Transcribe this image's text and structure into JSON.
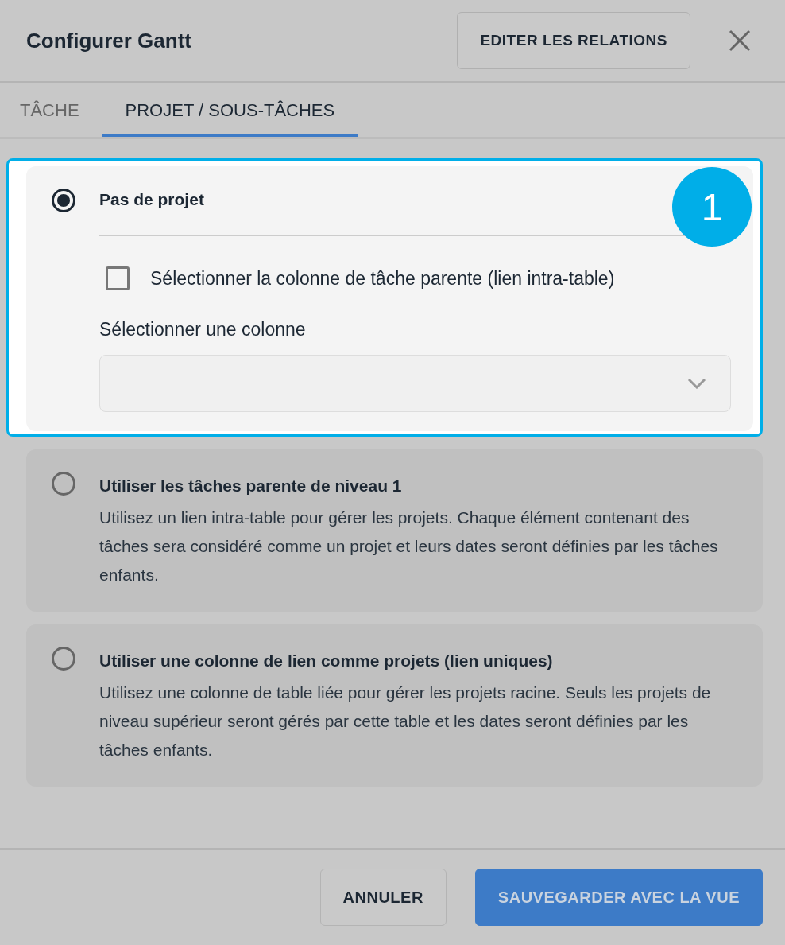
{
  "dialog": {
    "title": "Configurer Gantt",
    "header_button": "EDITER LES RELATIONS"
  },
  "tabs": [
    {
      "label": "TÂCHE",
      "selected": false
    },
    {
      "label": "PROJET / SOUS-TÂCHES",
      "selected": true
    }
  ],
  "options": [
    {
      "title": "Pas de projet",
      "selected": true,
      "highlighted": true,
      "step": "1",
      "checkbox": {
        "label": "Sélectionner la colonne de tâche parente (lien intra-table)",
        "checked": false
      },
      "select": {
        "label": "Sélectionner une colonne"
      }
    },
    {
      "title": "Utiliser les tâches parente de niveau 1",
      "selected": false,
      "highlighted": false,
      "description": "Utilisez un lien intra-table pour gérer les projets. Chaque élément contenant des tâches sera considéré comme un projet et leurs dates seront définies par les tâches enfants."
    },
    {
      "title": "Utiliser une colonne de lien comme projets (lien uniques)",
      "selected": false,
      "highlighted": false,
      "description": "Utilisez une colonne de table liée pour gérer les projets racine. Seuls les projets de niveau supérieur seront gérés par cette table et les dates seront définies par les tâches enfants."
    }
  ],
  "footer_buttons": [
    {
      "label": "ANNULER",
      "kind": "secondary"
    },
    {
      "label": "SAUVEGARDER AVEC LA VUE",
      "kind": "primary"
    }
  ]
}
